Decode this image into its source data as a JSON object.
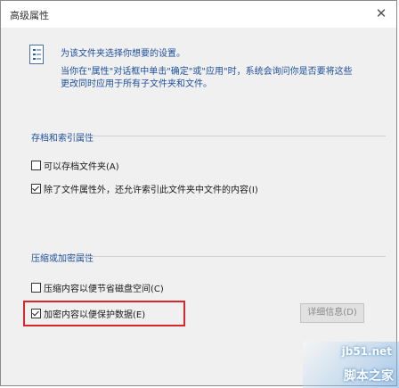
{
  "window": {
    "title": "高级属性",
    "close_glyph": "✕"
  },
  "info": {
    "line1": "为该文件夹选择你想要的设置。",
    "line2": "当你在\"属性\"对话框中单击\"确定\"或\"应用\"时，系统会询问你是否要将这些",
    "line3": "更改同时应用于所有子文件夹和文件。"
  },
  "archive_section": {
    "title": "存档和索引属性",
    "options": [
      {
        "label": "可以存档文件夹(A)",
        "checked": false
      },
      {
        "label": "除了文件属性外，还允许索引此文件夹中文件的内容(I)",
        "checked": true
      }
    ]
  },
  "compress_section": {
    "title": "压缩或加密属性",
    "options": [
      {
        "label": "压缩内容以便节省磁盘空间(C)",
        "checked": false
      },
      {
        "label": "加密内容以便保护数据(E)",
        "checked": true
      }
    ],
    "details_button": "详细信息(D)"
  },
  "watermark": {
    "top": "jb51.net",
    "bottom": "脚本之家"
  }
}
